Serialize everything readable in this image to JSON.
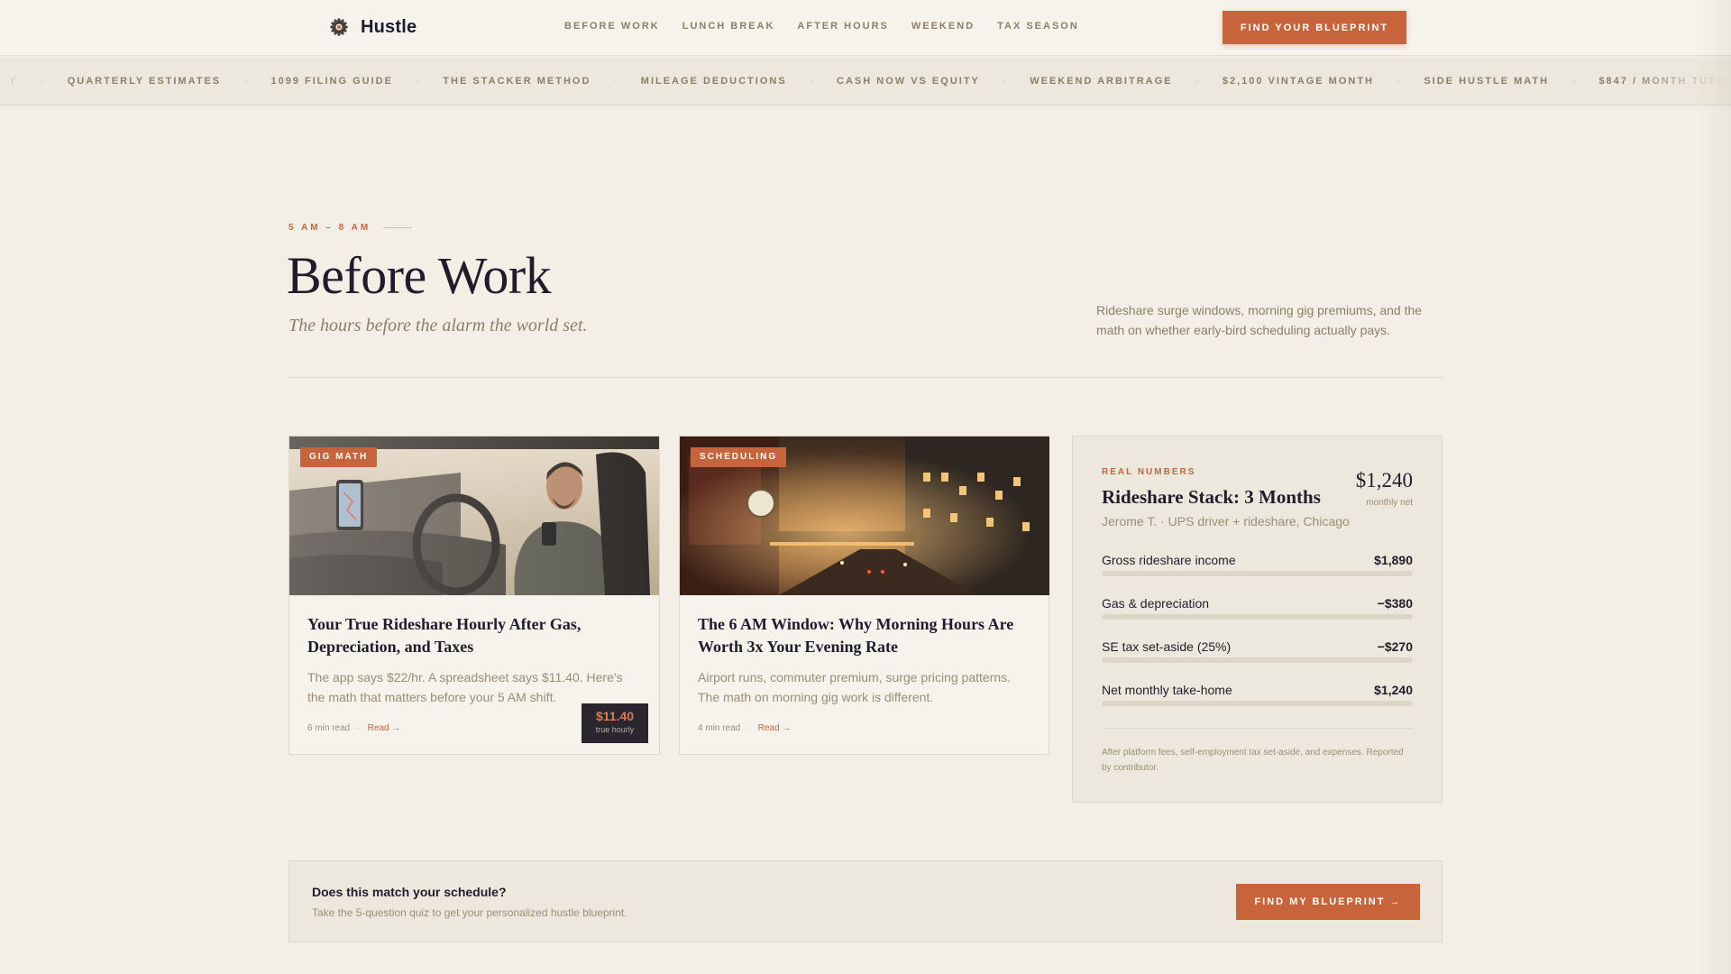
{
  "brand": {
    "name": "Hustle",
    "logo_icon": "asterisk-flower-icon"
  },
  "nav": {
    "items": [
      {
        "label": "BEFORE WORK"
      },
      {
        "label": "LUNCH BREAK"
      },
      {
        "label": "AFTER HOURS"
      },
      {
        "label": "WEEKEND"
      },
      {
        "label": "TAX SEASON"
      }
    ],
    "cta_label": "FIND YOUR BLUEPRINT"
  },
  "ticker": {
    "lead_fragment": "Y",
    "items": [
      "QUARTERLY ESTIMATES",
      "1099 FILING GUIDE",
      "THE STACKER METHOD",
      "MILEAGE DEDUCTIONS",
      "CASH NOW VS EQUITY",
      "WEEKEND ARBITRAGE",
      "$2,100 VINTAGE MONTH",
      "SIDE HUSTLE MATH",
      "$847 / MONTH TUTO"
    ],
    "separator": "·"
  },
  "hero": {
    "eyebrow": "5 AM – 8 AM",
    "title": "Before Work",
    "subtitle": "The hours before the alarm the world set.",
    "description": "Rideshare surge windows, morning gig premiums, and the math on whether early-bird scheduling actually pays."
  },
  "articles": [
    {
      "tag": "GIG MATH",
      "badge_value": "$11.40",
      "badge_label": "true hourly",
      "title": "Your True Rideshare Hourly After Gas, Depreciation, and Taxes",
      "excerpt": "The app says $22/hr. A spreadsheet says $11.40. Here's the math that matters before your 5 AM shift.",
      "read_time": "6 min read",
      "read_label": "Read →"
    },
    {
      "tag": "SCHEDULING",
      "title": "The 6 AM Window: Why Morning Hours Are Worth 3x Your Evening Rate",
      "excerpt": "Airport runs, commuter premium, surge pricing patterns. The math on morning gig work is different.",
      "read_time": "4 min read",
      "read_label": "Read →"
    }
  ],
  "panel": {
    "eyebrow": "REAL NUMBERS",
    "title": "Rideshare Stack: 3 Months",
    "subtitle": "Jerome T. · UPS driver + rideshare, Chicago",
    "amount": "$1,240",
    "amount_label": "monthly net",
    "rows": [
      {
        "label": "Gross rideshare income",
        "value": "$1,890"
      },
      {
        "label": "Gas & depreciation",
        "value": "−$380"
      },
      {
        "label": "SE tax set-aside (25%)",
        "value": "−$270"
      },
      {
        "label": "Net monthly take-home",
        "value": "$1,240"
      }
    ],
    "note": "After platform fees, self-employment tax set-aside, and expenses. Reported by contributor."
  },
  "banner": {
    "title": "Does this match your schedule?",
    "subtitle": "Take the 5-question quiz to get your personalized hustle blueprint.",
    "button_label": "FIND MY BLUEPRINT →"
  },
  "colors": {
    "accent": "#c8643b",
    "background": "#f3efe7",
    "panel": "#ede8dd",
    "muted_text": "#8a7f67",
    "ink": "#1f1d2b"
  }
}
